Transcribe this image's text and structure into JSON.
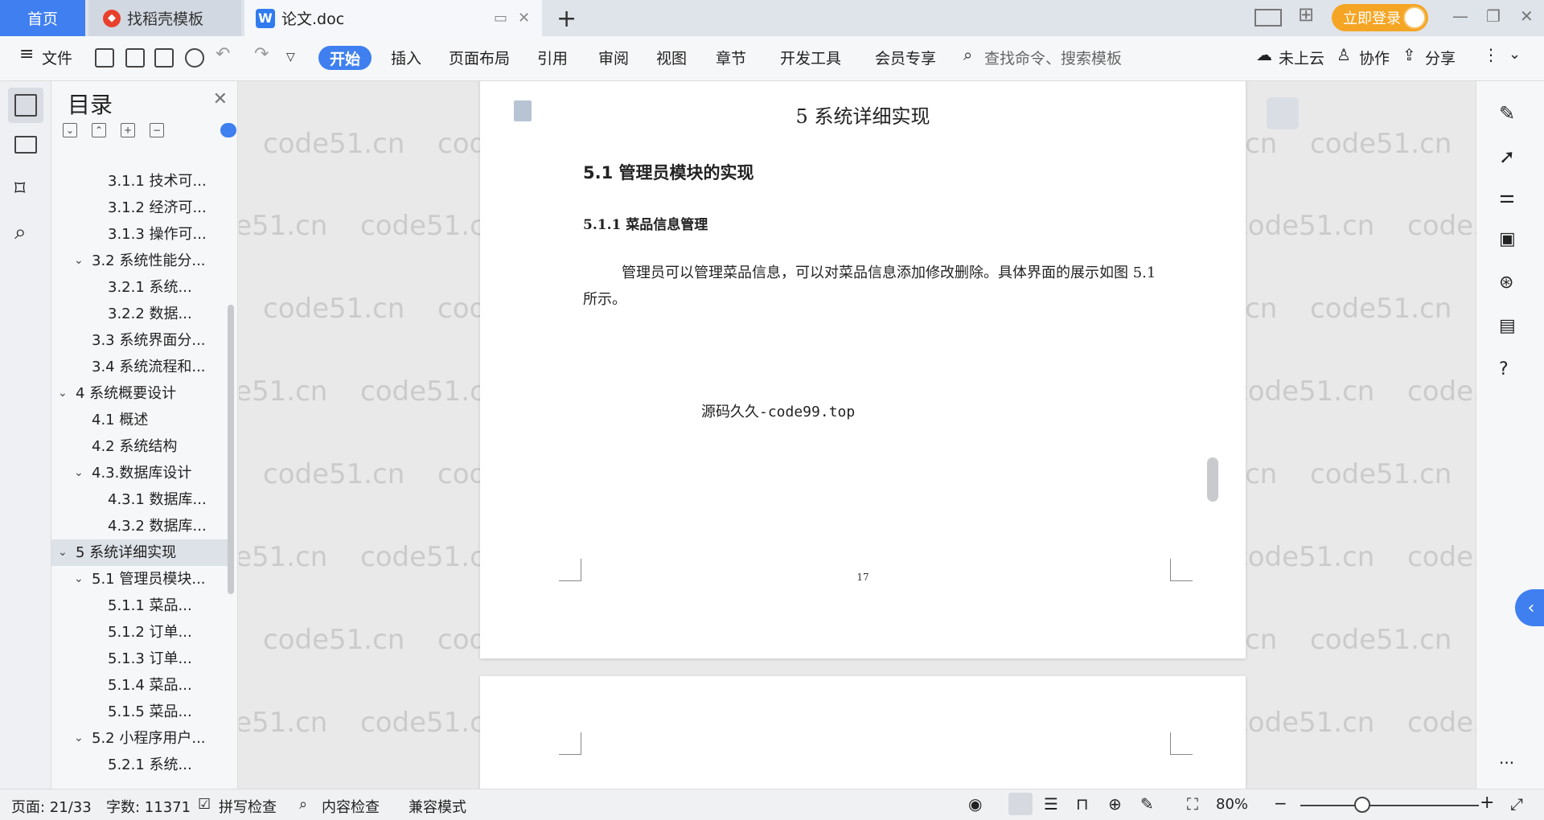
{
  "tabs": {
    "home": "首页",
    "docer": "找稻壳模板",
    "doc": "论文.doc",
    "new_tab": "+"
  },
  "login": {
    "label": "立即登录"
  },
  "menu": {
    "file": "文件",
    "items": [
      "开始",
      "插入",
      "页面布局",
      "引用",
      "审阅",
      "视图",
      "章节",
      "开发工具",
      "会员专享"
    ],
    "search_placeholder": "查找命令、搜索模板",
    "cloud": "未上云",
    "collab": "协作",
    "share": "分享"
  },
  "outline": {
    "title": "目录",
    "items": [
      {
        "label": "3.1.1 技术可...",
        "level": 3
      },
      {
        "label": "3.1.2 经济可...",
        "level": 3
      },
      {
        "label": "3.1.3 操作可...",
        "level": 3
      },
      {
        "label": "3.2 系统性能分...",
        "level": 2,
        "chev": true
      },
      {
        "label": "3.2.1  系统...",
        "level": 3
      },
      {
        "label": "3.2.2  数据...",
        "level": 3
      },
      {
        "label": "3.3 系统界面分...",
        "level": 2
      },
      {
        "label": "3.4 系统流程和...",
        "level": 2
      },
      {
        "label": "4 系统概要设计",
        "level": 1,
        "chev": true
      },
      {
        "label": "4.1 概述",
        "level": 2
      },
      {
        "label": "4.2 系统结构",
        "level": 2
      },
      {
        "label": "4.3.数据库设计",
        "level": 2,
        "chev": true
      },
      {
        "label": "4.3.1 数据库...",
        "level": 3
      },
      {
        "label": "4.3.2 数据库...",
        "level": 3
      },
      {
        "label": "5 系统详细实现",
        "level": 1,
        "chev": true,
        "selected": true
      },
      {
        "label": "5.1  管理员模块...",
        "level": 2,
        "chev": true
      },
      {
        "label": "5.1.1  菜品...",
        "level": 3
      },
      {
        "label": "5.1.2  订单...",
        "level": 3
      },
      {
        "label": "5.1.3  订单...",
        "level": 3
      },
      {
        "label": "5.1.4  菜品...",
        "level": 3
      },
      {
        "label": "5.1.5  菜品...",
        "level": 3
      },
      {
        "label": "5.2  小程序用户...",
        "level": 2,
        "chev": true
      },
      {
        "label": "5.2.1  系统...",
        "level": 3
      }
    ]
  },
  "document": {
    "chapter_title": "5 系统详细实现",
    "section_title": "5.1  管理员模块的实现",
    "subsection_title": "5.1.1  菜品信息管理",
    "paragraph": "管理员可以管理菜品信息，可以对菜品信息添加修改删除。具体界面的展示如图 5.1 所示。",
    "image_caption": "源码久久-code99.top",
    "page_number": "17",
    "watermark": "code51.cn"
  },
  "status": {
    "page": "页面: 21/33",
    "words": "字数: 11371",
    "spell": "拼写检查",
    "content_check": "内容检查",
    "compat": "兼容模式",
    "zoom": "80%"
  },
  "colors": {
    "accent": "#3f7ff0",
    "login": "#f5a524"
  }
}
